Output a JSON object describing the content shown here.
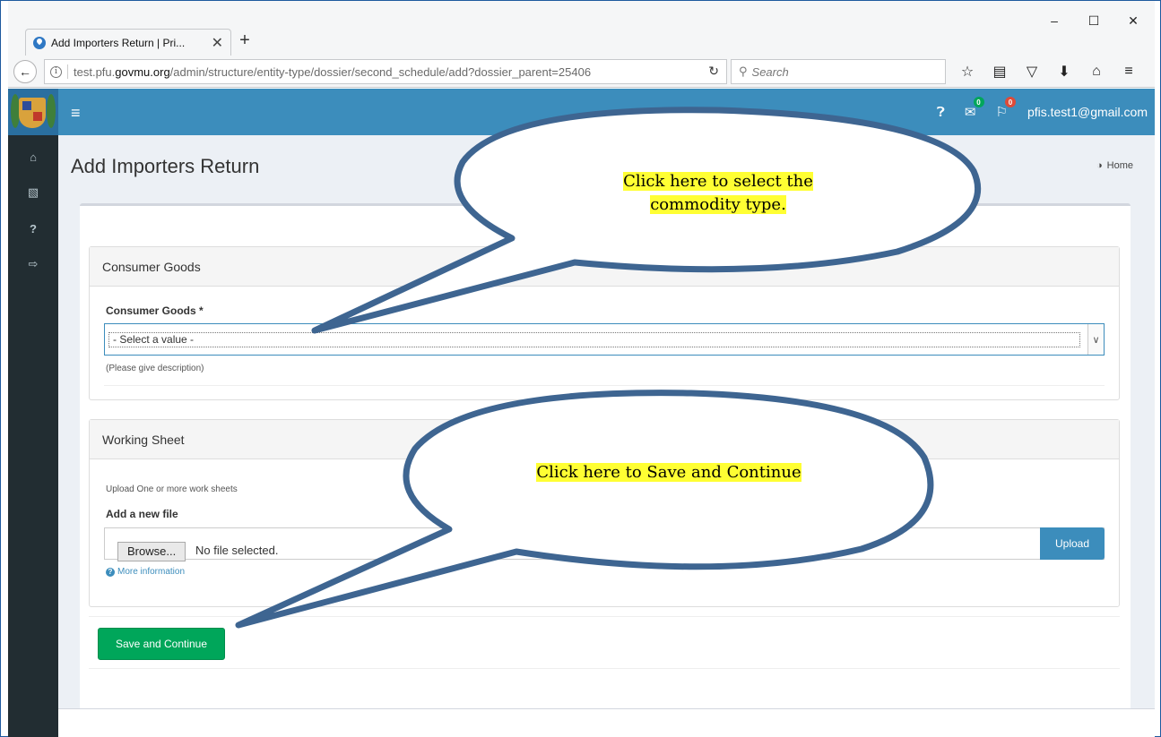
{
  "browser": {
    "tab_title": "Add Importers Return | Pri...",
    "tab_close": "✕",
    "new_tab": "+",
    "url_host_prefix": "test.pfu.",
    "url_host": "govmu.org",
    "url_path": "/admin/structure/entity-type/dossier/second_schedule/add?dossier_parent=25406",
    "search_placeholder": "Search",
    "window_controls": [
      "–",
      "☐",
      "✕"
    ]
  },
  "header": {
    "user_email": "pfis.test1@gmail.com",
    "messages_count": "0",
    "flags_count": "0"
  },
  "page": {
    "title": "Add Importers Return",
    "breadcrumb_home": "Home"
  },
  "consumer_goods": {
    "panel_title": "Consumer Goods",
    "field_label": "Consumer Goods *",
    "select_value": "- Select a value -",
    "help_text": "(Please give description)"
  },
  "working_sheet": {
    "panel_title": "Working Sheet",
    "help_text": "Upload One or more work sheets",
    "field_label": "Add a new file",
    "browse_label": "Browse...",
    "file_status": "No file selected.",
    "upload_label": "Upload",
    "more_info": "More information"
  },
  "actions": {
    "save_continue": "Save and Continue"
  },
  "callouts": {
    "top_line1": "Click here to select the",
    "top_line2": "commodity type.",
    "bottom": "Click here to Save and Continue"
  }
}
